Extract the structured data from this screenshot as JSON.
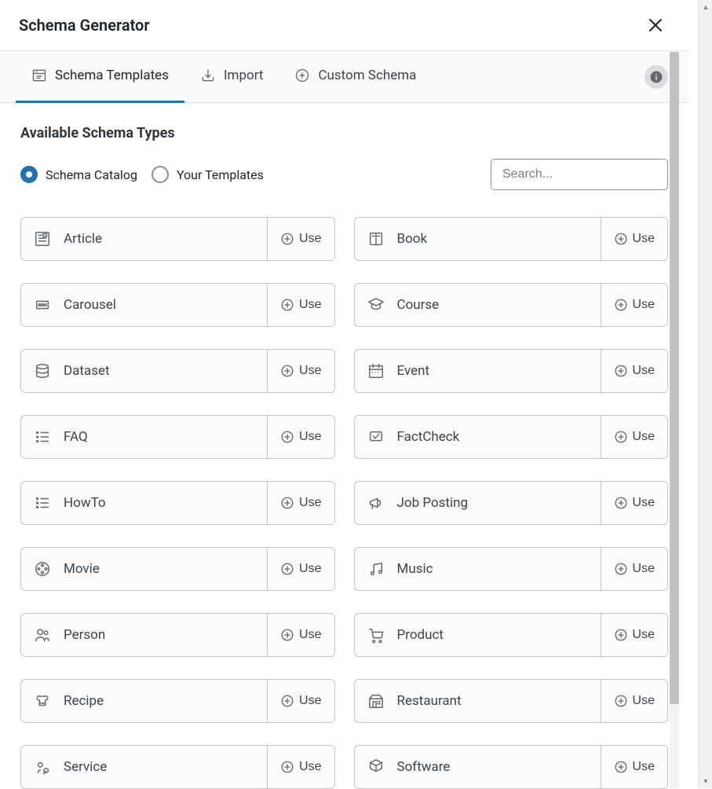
{
  "modal": {
    "title": "Schema Generator"
  },
  "tabs": {
    "templates": "Schema Templates",
    "import": "Import",
    "custom": "Custom Schema"
  },
  "section": {
    "heading": "Available Schema Types"
  },
  "radios": {
    "catalog": "Schema Catalog",
    "templates": "Your Templates"
  },
  "search": {
    "placeholder": "Search..."
  },
  "use_label": "Use",
  "schemas": [
    {
      "key": "article",
      "label": "Article",
      "icon": "article"
    },
    {
      "key": "book",
      "label": "Book",
      "icon": "book"
    },
    {
      "key": "carousel",
      "label": "Carousel",
      "icon": "carousel"
    },
    {
      "key": "course",
      "label": "Course",
      "icon": "course"
    },
    {
      "key": "dataset",
      "label": "Dataset",
      "icon": "dataset"
    },
    {
      "key": "event",
      "label": "Event",
      "icon": "event"
    },
    {
      "key": "faq",
      "label": "FAQ",
      "icon": "list"
    },
    {
      "key": "factcheck",
      "label": "FactCheck",
      "icon": "factcheck"
    },
    {
      "key": "howto",
      "label": "HowTo",
      "icon": "list"
    },
    {
      "key": "jobposting",
      "label": "Job Posting",
      "icon": "megaphone"
    },
    {
      "key": "movie",
      "label": "Movie",
      "icon": "movie"
    },
    {
      "key": "music",
      "label": "Music",
      "icon": "music"
    },
    {
      "key": "person",
      "label": "Person",
      "icon": "person"
    },
    {
      "key": "product",
      "label": "Product",
      "icon": "product"
    },
    {
      "key": "recipe",
      "label": "Recipe",
      "icon": "recipe"
    },
    {
      "key": "restaurant",
      "label": "Restaurant",
      "icon": "restaurant"
    },
    {
      "key": "service",
      "label": "Service",
      "icon": "service"
    },
    {
      "key": "software",
      "label": "Software",
      "icon": "software"
    }
  ]
}
